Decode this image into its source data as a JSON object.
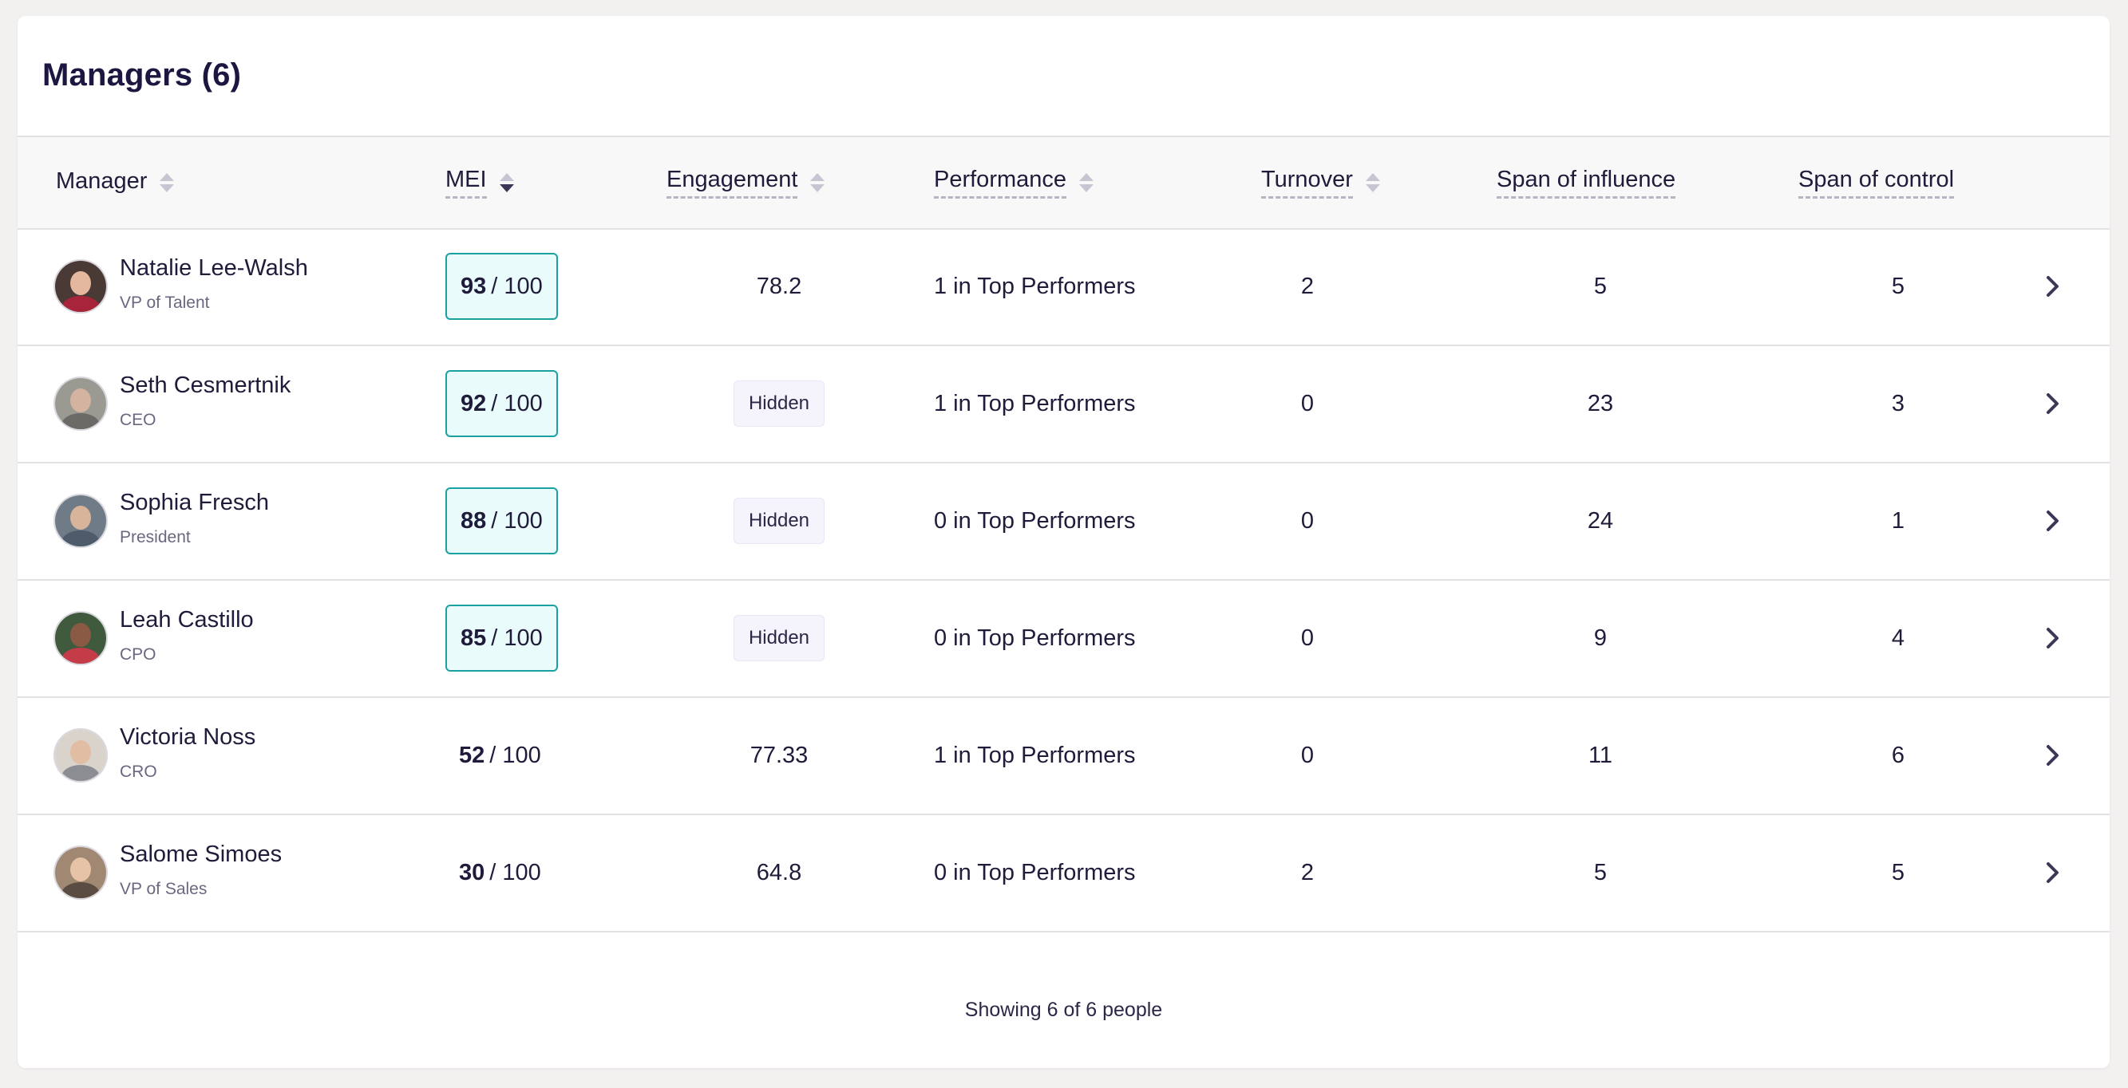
{
  "panel": {
    "title": "Managers (6)"
  },
  "columns": {
    "manager": "Manager",
    "mei": "MEI",
    "engagement": "Engagement",
    "performance": "Performance",
    "turnover": "Turnover",
    "span_influence": "Span of influence",
    "span_control": "Span of control"
  },
  "rows": [
    {
      "name": "Natalie Lee-Walsh",
      "title": "VP of Talent",
      "mei_score": "93",
      "mei_total": "/ 100",
      "mei_highlight": true,
      "engagement": "78.2",
      "performance": "1 in Top Performers",
      "turnover": "2",
      "span_influence": "5",
      "span_control": "5"
    },
    {
      "name": "Seth Cesmertnik",
      "title": "CEO",
      "mei_score": "92",
      "mei_total": "/ 100",
      "mei_highlight": true,
      "engagement": "Hidden",
      "performance": "1 in Top Performers",
      "turnover": "0",
      "span_influence": "23",
      "span_control": "3"
    },
    {
      "name": "Sophia Fresch",
      "title": "President",
      "mei_score": "88",
      "mei_total": "/ 100",
      "mei_highlight": true,
      "engagement": "Hidden",
      "performance": "0 in Top Performers",
      "turnover": "0",
      "span_influence": "24",
      "span_control": "1"
    },
    {
      "name": "Leah Castillo",
      "title": "CPO",
      "mei_score": "85",
      "mei_total": "/ 100",
      "mei_highlight": true,
      "engagement": "Hidden",
      "performance": "0 in Top Performers",
      "turnover": "0",
      "span_influence": "9",
      "span_control": "4"
    },
    {
      "name": "Victoria Noss",
      "title": "CRO",
      "mei_score": "52",
      "mei_total": "/ 100",
      "mei_highlight": false,
      "engagement": "77.33",
      "performance": "1 in Top Performers",
      "turnover": "0",
      "span_influence": "11",
      "span_control": "6"
    },
    {
      "name": "Salome Simoes",
      "title": "VP of Sales",
      "mei_score": "30",
      "mei_total": "/ 100",
      "mei_highlight": false,
      "engagement": "64.8",
      "performance": "0 in Top Performers",
      "turnover": "2",
      "span_influence": "5",
      "span_control": "5"
    }
  ],
  "footer": {
    "text": "Showing 6 of 6 people"
  },
  "colors": {
    "accent": "#1aa2a2",
    "highlight_bg": "#eafbfb",
    "text": "#1f1b3a"
  },
  "icons": {
    "row_action": "chevron-right-icon",
    "sort": "sort-icon",
    "sort_active": "sort-desc-icon"
  }
}
